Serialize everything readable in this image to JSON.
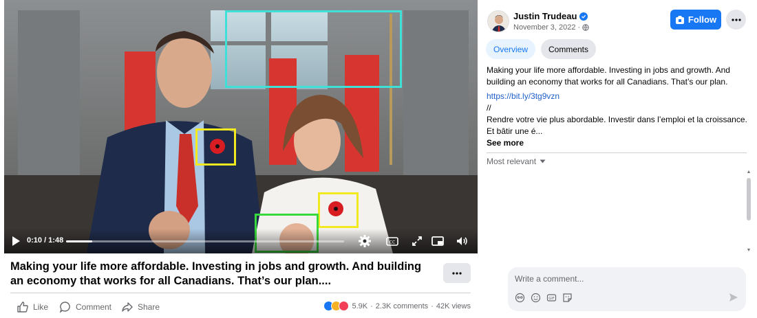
{
  "video": {
    "time": "0:10 / 1:48",
    "progress_fraction": 0.093
  },
  "post": {
    "caption": "Making your life more affordable. Investing in jobs and growth. And building an economy that works for all Canadians. That’s our plan....",
    "actions": {
      "like": "Like",
      "comment": "Comment",
      "share": "Share"
    },
    "stats": {
      "reactions": "5.9K",
      "comments": "2.3K comments",
      "views": "42K views",
      "separator": "·"
    }
  },
  "sidebar": {
    "author": "Justin Trudeau",
    "date": "November 3, 2022 ·",
    "follow_label": "Follow",
    "tabs": [
      "Overview",
      "Comments"
    ],
    "description": {
      "line1": "Making your life more affordable. Investing in jobs and growth. And building an economy that works for all Canadians. That’s our plan.",
      "link": "https://bit.ly/3tg9vzn",
      "slashes": "//",
      "line2": "Rendre votre vie plus abordable. Investir dans l’emploi et la croissance. Et bâtir une é...",
      "see_more": "See more"
    },
    "sort_label": "Most relevant",
    "comment_placeholder": "Write a comment..."
  },
  "annotation_colors": {
    "cyan": "#3ee0d8",
    "yellow": "#f2ea1f",
    "green": "#38d93c"
  }
}
